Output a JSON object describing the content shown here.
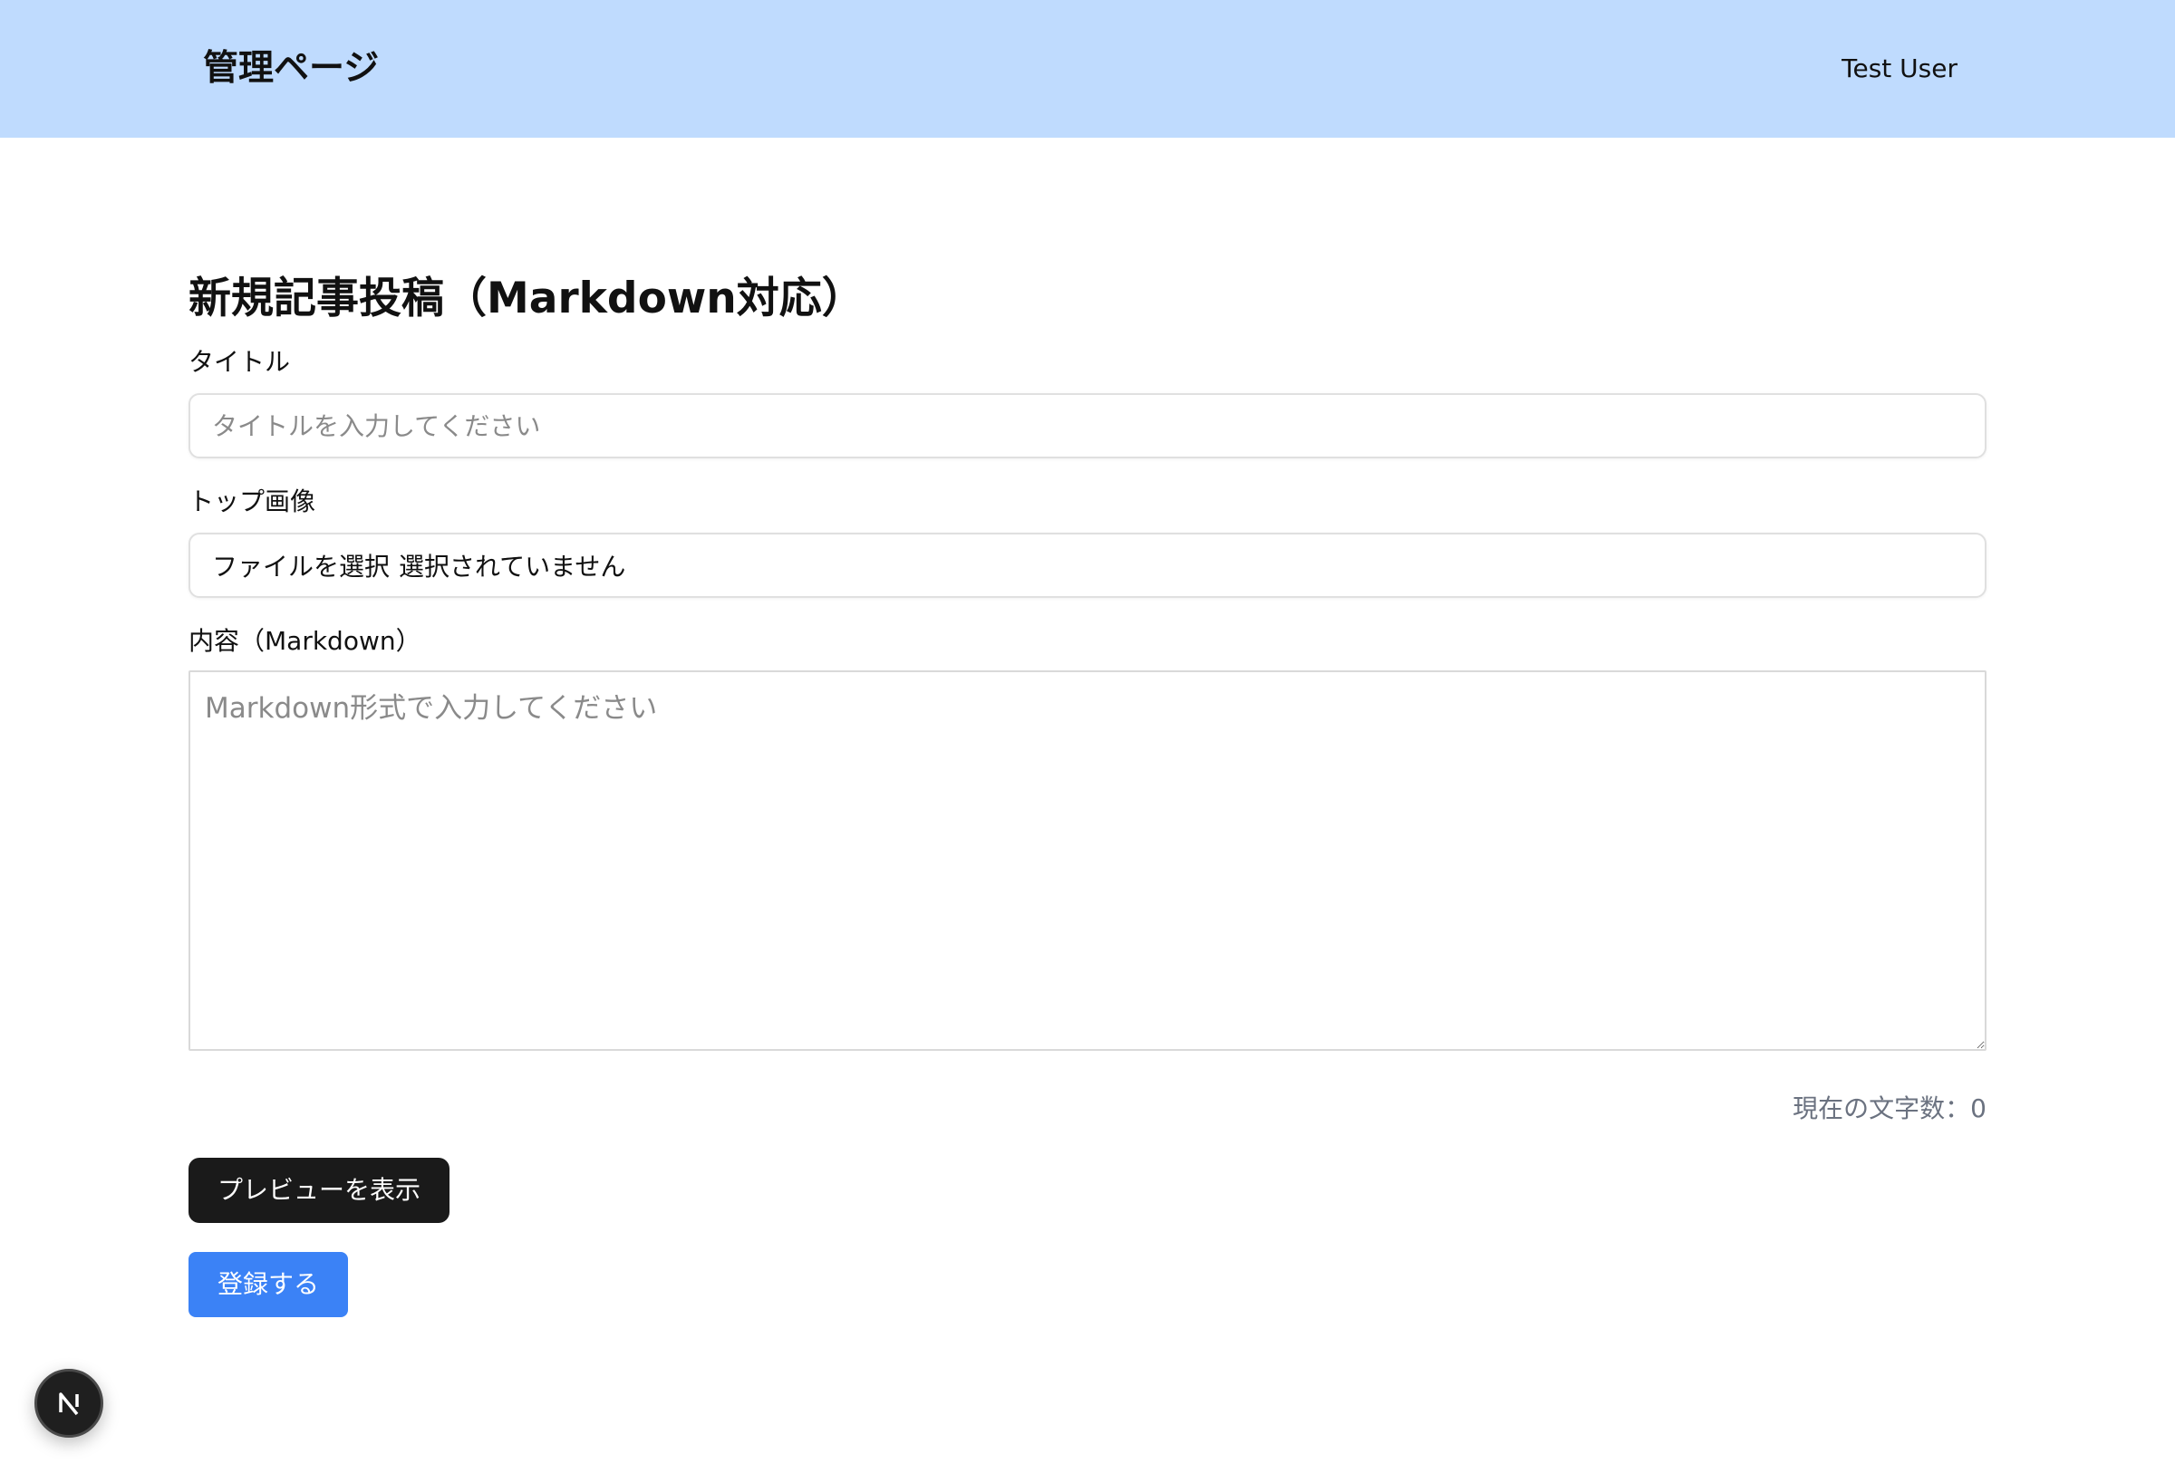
{
  "header": {
    "title": "管理ページ",
    "user_name": "Test User",
    "background_color": "#bfdbfe"
  },
  "form": {
    "heading": "新規記事投稿（Markdown対応）",
    "title_field": {
      "label": "タイトル",
      "placeholder": "タイトルを入力してください",
      "value": ""
    },
    "image_field": {
      "label": "トップ画像",
      "button_label": "ファイルを選択",
      "status_text": "選択されていません"
    },
    "content_field": {
      "label": "内容（Markdown）",
      "placeholder": "Markdown形式で入力してください",
      "value": ""
    },
    "char_count_text": "現在の文字数：0",
    "preview_button_label": "プレビューを表示",
    "submit_button_label": "登録する",
    "preview_button_color": "#1a1a1a",
    "submit_button_color": "#3b82f6"
  },
  "dev_indicator": {
    "icon": "nextjs-logo-icon",
    "letter": "N"
  }
}
